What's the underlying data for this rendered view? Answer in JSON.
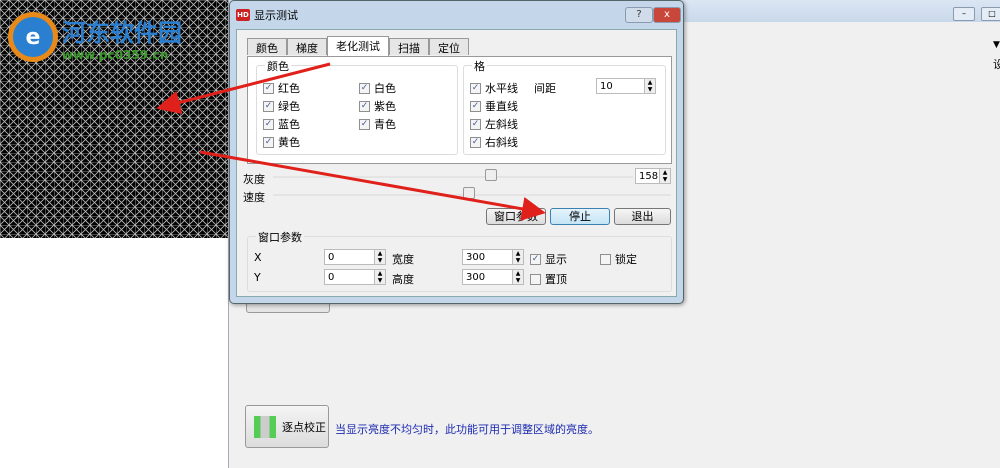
{
  "watermark": {
    "name": "河东软件园",
    "url": "www.pc0359.cn"
  },
  "dialog": {
    "title": "显示测试",
    "help": "?",
    "close": "x",
    "tabs": [
      "颜色",
      "梯度",
      "老化测试",
      "扫描",
      "定位"
    ],
    "active_tab": "老化测试",
    "color_group": {
      "label": "颜色",
      "items": [
        {
          "label": "红色",
          "checked": true
        },
        {
          "label": "白色",
          "checked": true
        },
        {
          "label": "绿色",
          "checked": true
        },
        {
          "label": "紫色",
          "checked": true
        },
        {
          "label": "蓝色",
          "checked": true
        },
        {
          "label": "青色",
          "checked": true
        },
        {
          "label": "黄色",
          "checked": true
        }
      ]
    },
    "grid_group": {
      "label": "格",
      "items": [
        {
          "label": "水平线",
          "checked": true
        },
        {
          "label": "垂直线",
          "checked": true
        },
        {
          "label": "左斜线",
          "checked": true
        },
        {
          "label": "右斜线",
          "checked": true
        }
      ],
      "spacing_label": "间距",
      "spacing_value": "10"
    },
    "gray": {
      "label": "灰度",
      "value": "158",
      "fraction": 0.5
    },
    "speed": {
      "label": "速度",
      "fraction": 0.43
    },
    "buttons": {
      "window_params": "窗口参数",
      "stop": "停止",
      "exit": "退出"
    },
    "window_params": {
      "label": "窗口参数",
      "x_label": "X",
      "x_value": "0",
      "y_label": "Y",
      "y_value": "0",
      "width_label": "宽度",
      "width_value": "300",
      "height_label": "高度",
      "height_value": "300",
      "show_label": "显示",
      "show_checked": true,
      "top_label": "置顶",
      "top_checked": false,
      "lock_label": "锁定",
      "lock_checked": false
    }
  },
  "main": {
    "point_correction": "逐点校正",
    "note": "当显示亮度不均匀时，此功能可用于调整区域的亮度。",
    "side_text": "设",
    "min": "–",
    "max": "□"
  }
}
